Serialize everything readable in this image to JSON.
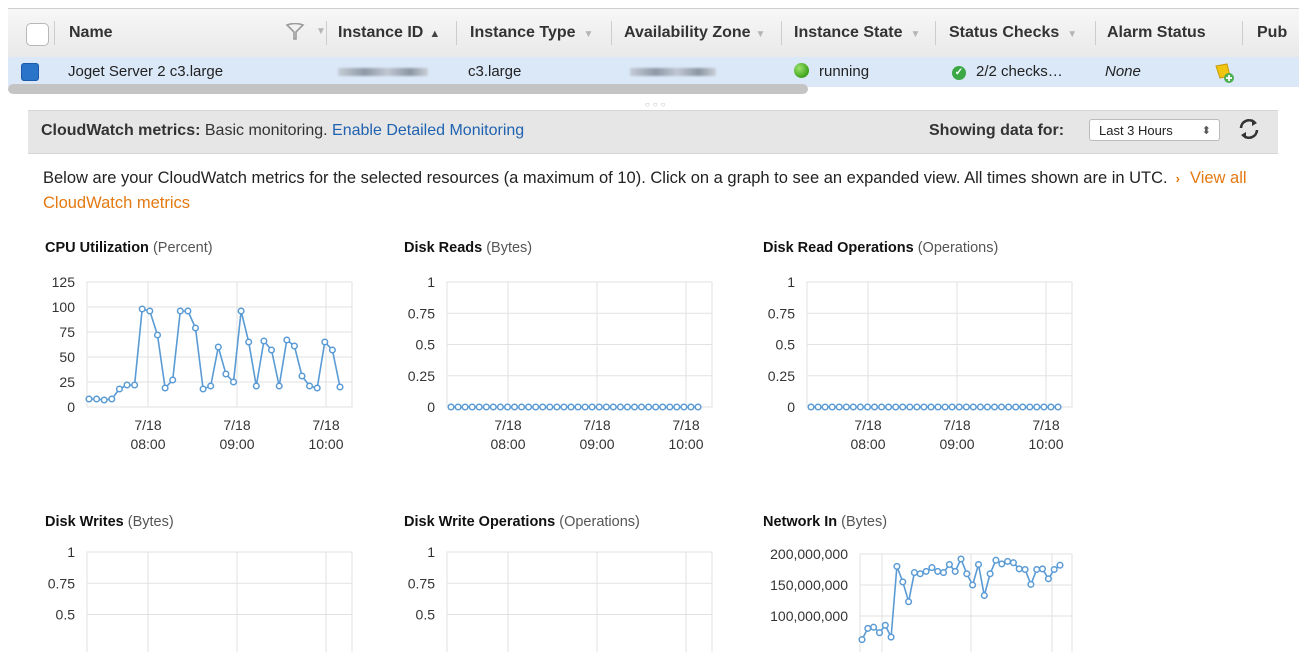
{
  "table": {
    "columns": {
      "name": "Name",
      "instance_id": "Instance ID",
      "instance_type": "Instance Type",
      "availability_zone": "Availability Zone",
      "instance_state": "Instance State",
      "status_checks": "Status Checks",
      "alarm_status": "Alarm Status",
      "public": "Pub"
    },
    "row": {
      "name": "Joget Server 2 c3.large",
      "instance_type": "c3.large",
      "instance_state": "running",
      "status_checks": "2/2 checks…",
      "alarm_status": "None"
    },
    "state_color": "#3ea21b",
    "selected_row_color": "#dbe8f8"
  },
  "cloudwatch": {
    "title": "CloudWatch metrics:",
    "monitoring_text": "Basic monitoring.",
    "enable_link": "Enable Detailed Monitoring",
    "showing_label": "Showing data for:",
    "range_value": "Last 3 Hours",
    "intro_text": "Below are your CloudWatch metrics for the selected resources (a maximum of 10). Click on a graph to see an expanded view. All times shown are in UTC.",
    "view_all_link": "View all CloudWatch metrics",
    "link_color": "#1f62b0",
    "accent_orange": "#e47911"
  },
  "chart_data": [
    {
      "type": "line",
      "title": "CPU Utilization",
      "unit": "(Percent)",
      "x_ticks": [
        [
          "7/18",
          "08:00"
        ],
        [
          "7/18",
          "09:00"
        ],
        [
          "7/18",
          "10:00"
        ]
      ],
      "y_ticks": [
        "125",
        "100",
        "75",
        "50",
        "25",
        "0"
      ],
      "ylim": [
        0,
        125
      ],
      "x_range": [
        "07:20",
        "10:20"
      ],
      "x": [
        "07:20",
        "07:25",
        "07:30",
        "07:35",
        "07:40",
        "07:45",
        "07:50",
        "07:55",
        "08:00",
        "08:05",
        "08:10",
        "08:15",
        "08:20",
        "08:25",
        "08:30",
        "08:35",
        "08:40",
        "08:45",
        "08:50",
        "08:55",
        "09:00",
        "09:05",
        "09:10",
        "09:15",
        "09:20",
        "09:25",
        "09:30",
        "09:35",
        "09:40",
        "09:45",
        "09:50",
        "09:55",
        "10:00",
        "10:05",
        "10:10"
      ],
      "values": [
        8,
        8,
        7,
        8,
        18,
        22,
        22,
        98,
        96,
        72,
        19,
        27,
        96,
        96,
        79,
        18,
        21,
        60,
        33,
        25,
        96,
        65,
        21,
        66,
        57,
        21,
        67,
        61,
        31,
        21,
        19,
        65,
        57,
        20
      ],
      "color": "#5a9bd5",
      "grid": true
    },
    {
      "type": "line",
      "title": "Disk Reads",
      "unit": "(Bytes)",
      "x_ticks": [
        [
          "7/18",
          "08:00"
        ],
        [
          "7/18",
          "09:00"
        ],
        [
          "7/18",
          "10:00"
        ]
      ],
      "y_ticks": [
        "1",
        "0.75",
        "0.5",
        "0.25",
        "0"
      ],
      "ylim": [
        0,
        1
      ],
      "values": [
        0,
        0,
        0,
        0,
        0,
        0,
        0,
        0,
        0,
        0,
        0,
        0,
        0,
        0,
        0,
        0,
        0,
        0,
        0,
        0,
        0,
        0,
        0,
        0,
        0,
        0,
        0,
        0,
        0,
        0,
        0,
        0,
        0,
        0,
        0,
        0
      ],
      "color": "#5a9bd5",
      "grid": true
    },
    {
      "type": "line",
      "title": "Disk Read Operations",
      "unit": "(Operations)",
      "x_ticks": [
        [
          "7/18",
          "08:00"
        ],
        [
          "7/18",
          "09:00"
        ],
        [
          "7/18",
          "10:00"
        ]
      ],
      "y_ticks": [
        "1",
        "0.75",
        "0.5",
        "0.25",
        "0"
      ],
      "ylim": [
        0,
        1
      ],
      "values": [
        0,
        0,
        0,
        0,
        0,
        0,
        0,
        0,
        0,
        0,
        0,
        0,
        0,
        0,
        0,
        0,
        0,
        0,
        0,
        0,
        0,
        0,
        0,
        0,
        0,
        0,
        0,
        0,
        0,
        0,
        0,
        0,
        0,
        0,
        0,
        0
      ],
      "color": "#5a9bd5",
      "grid": true
    },
    {
      "type": "line",
      "title": "Disk Writes",
      "unit": "(Bytes)",
      "y_ticks": [
        "1",
        "0.75",
        "0.5"
      ],
      "ylim": [
        0,
        1
      ],
      "values": [],
      "color": "#5a9bd5",
      "grid": true
    },
    {
      "type": "line",
      "title": "Disk Write Operations",
      "unit": "(Operations)",
      "y_ticks": [
        "1",
        "0.75",
        "0.5"
      ],
      "ylim": [
        0,
        1
      ],
      "values": [],
      "color": "#5a9bd5",
      "grid": true
    },
    {
      "type": "line",
      "title": "Network In",
      "unit": "(Bytes)",
      "y_ticks": [
        "200,000,000",
        "150,000,000",
        "100,000,000"
      ],
      "ylim": [
        100000000,
        200000000
      ],
      "values": [
        62000000,
        80000000,
        82000000,
        73000000,
        85000000,
        66000000,
        180000000,
        155000000,
        123000000,
        170000000,
        168000000,
        172000000,
        178000000,
        172000000,
        170000000,
        183000000,
        172000000,
        192000000,
        168000000,
        150000000,
        183000000,
        133000000,
        168000000,
        190000000,
        184000000,
        188000000,
        186000000,
        176000000,
        175000000,
        151000000,
        175000000,
        176000000,
        160000000,
        175000000,
        182000000
      ],
      "color": "#5a9bd5",
      "grid": true
    }
  ]
}
